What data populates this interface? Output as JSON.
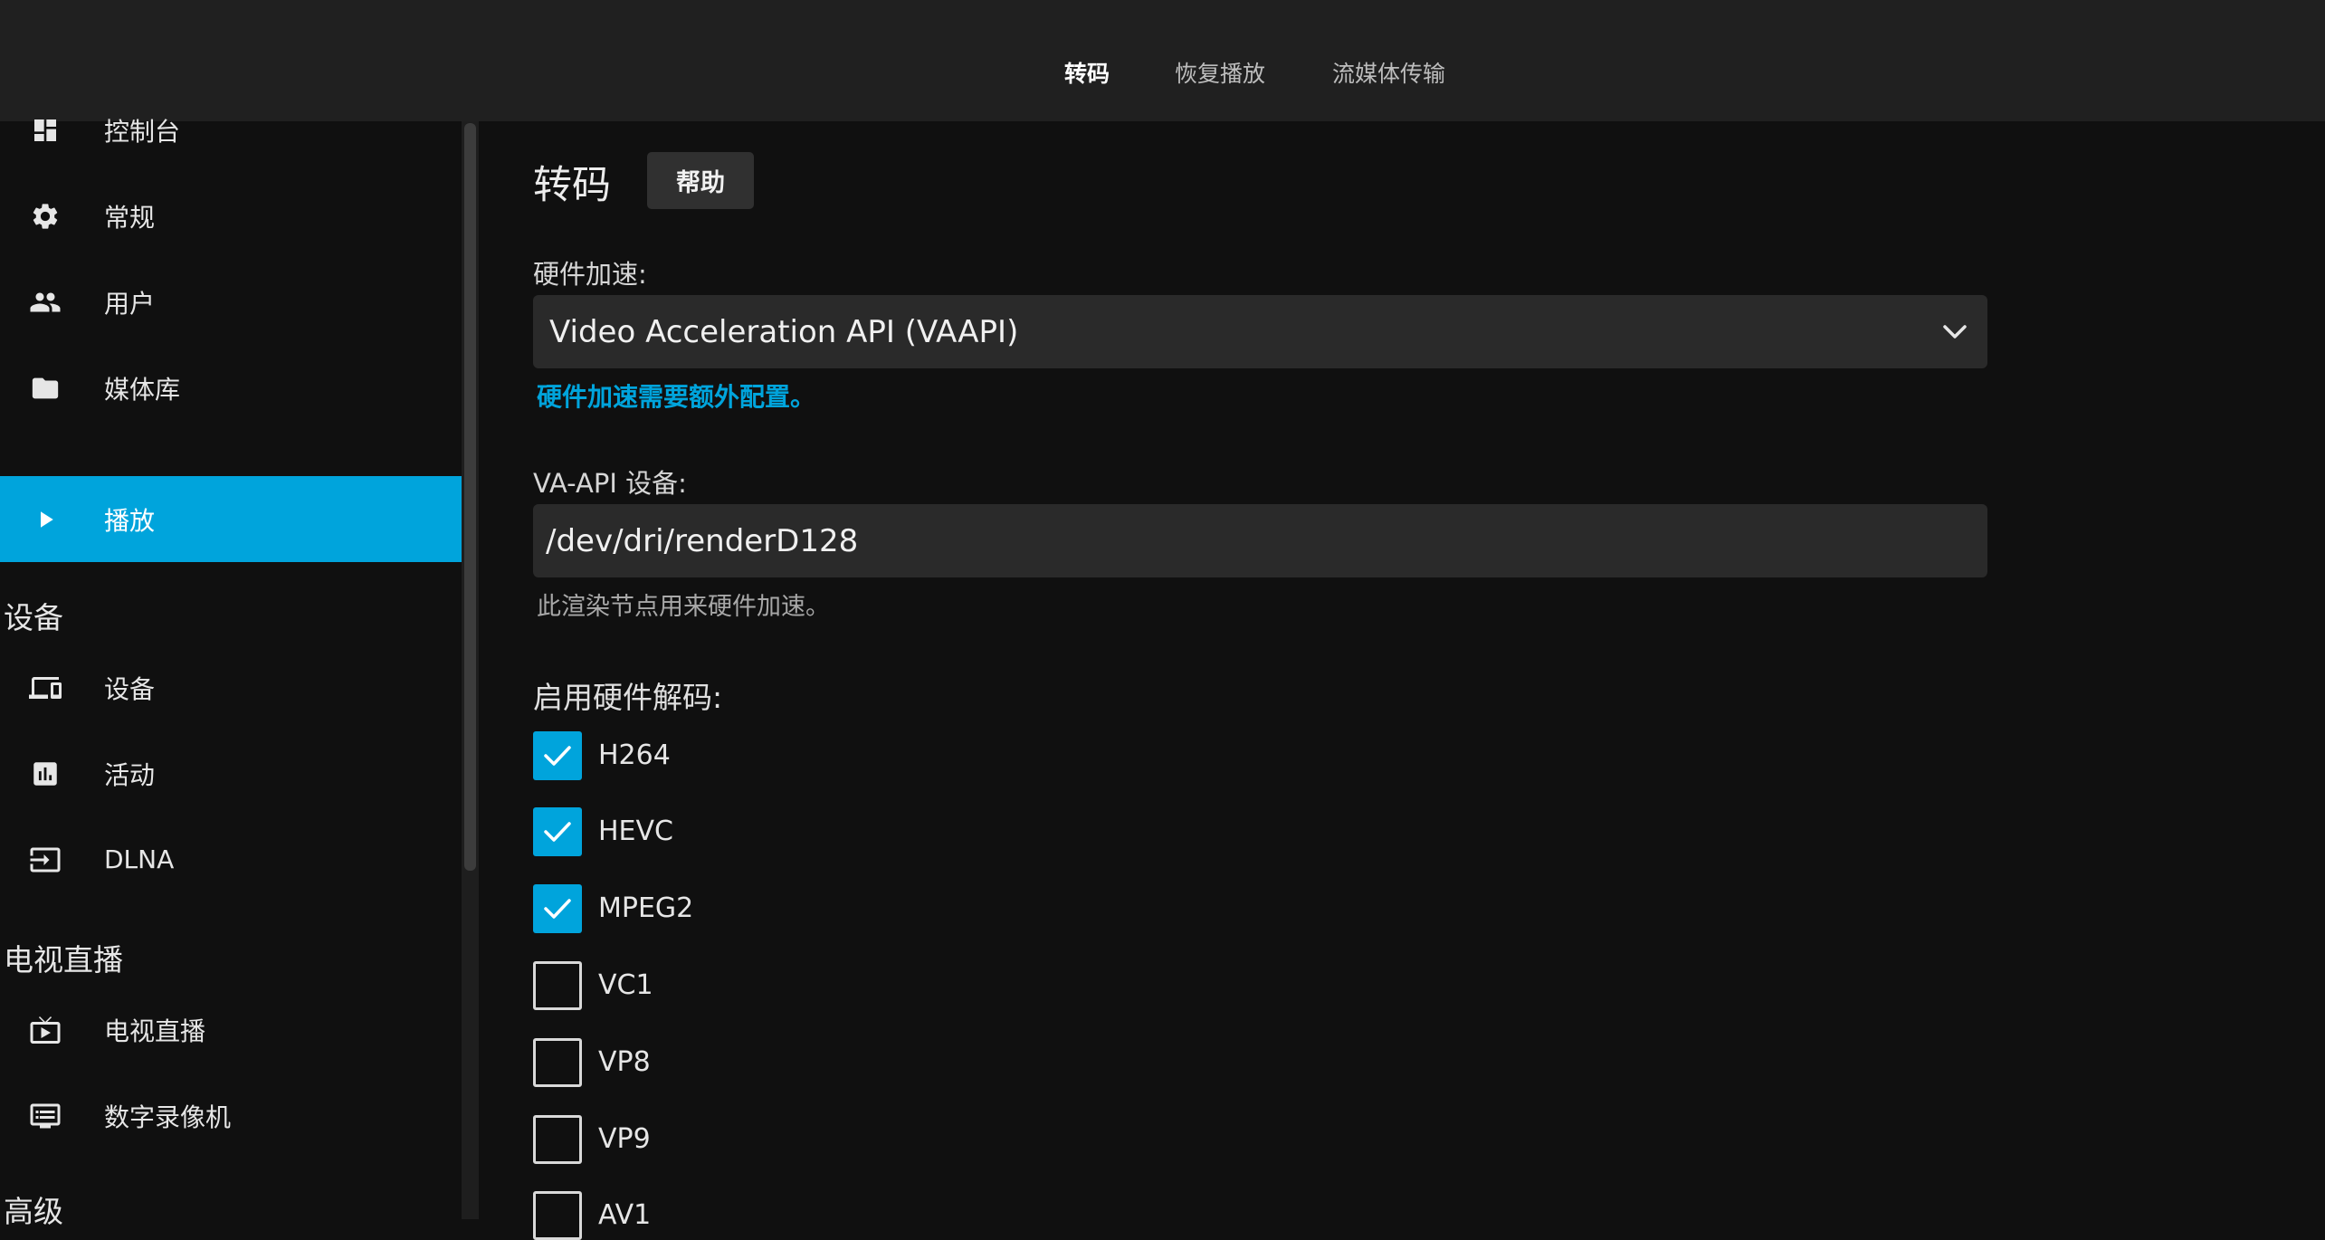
{
  "header": {
    "tabs": [
      {
        "label": "转码",
        "active": true
      },
      {
        "label": "恢复播放",
        "active": false
      },
      {
        "label": "流媒体传输",
        "active": false
      }
    ]
  },
  "sidebar": {
    "items": [
      {
        "label": "控制台",
        "icon": "dashboard-icon"
      },
      {
        "label": "常规",
        "icon": "gear-icon"
      },
      {
        "label": "用户",
        "icon": "people-icon"
      },
      {
        "label": "媒体库",
        "icon": "folder-icon"
      },
      {
        "label": "播放",
        "icon": "play-icon",
        "active": true
      }
    ],
    "section_devices": "设备",
    "devices_items": [
      {
        "label": "设备",
        "icon": "devices-icon"
      },
      {
        "label": "活动",
        "icon": "activity-icon"
      },
      {
        "label": "DLNA",
        "icon": "input-icon"
      }
    ],
    "section_livetv": "电视直播",
    "livetv_items": [
      {
        "label": "电视直播",
        "icon": "live-tv-icon"
      },
      {
        "label": "数字录像机",
        "icon": "dvr-icon"
      }
    ],
    "section_advanced": "高级"
  },
  "main": {
    "title": "转码",
    "help_label": "帮助",
    "hw_accel_label": "硬件加速:",
    "hw_accel_value": "Video Acceleration API (VAAPI)",
    "hw_accel_note": "硬件加速需要额外配置。",
    "vaapi_label": "VA-API 设备:",
    "vaapi_value": "/dev/dri/renderD128",
    "vaapi_note": "此渲染节点用来硬件加速。",
    "hw_decode_label": "启用硬件解码:",
    "codecs": [
      {
        "label": "H264",
        "checked": true
      },
      {
        "label": "HEVC",
        "checked": true
      },
      {
        "label": "MPEG2",
        "checked": true
      },
      {
        "label": "VC1",
        "checked": false
      },
      {
        "label": "VP8",
        "checked": false
      },
      {
        "label": "VP9",
        "checked": false
      },
      {
        "label": "AV1",
        "checked": false
      }
    ]
  },
  "colors": {
    "accent": "#00a4dc",
    "background": "#101010",
    "header": "#202020",
    "input": "#2a2a2a"
  }
}
